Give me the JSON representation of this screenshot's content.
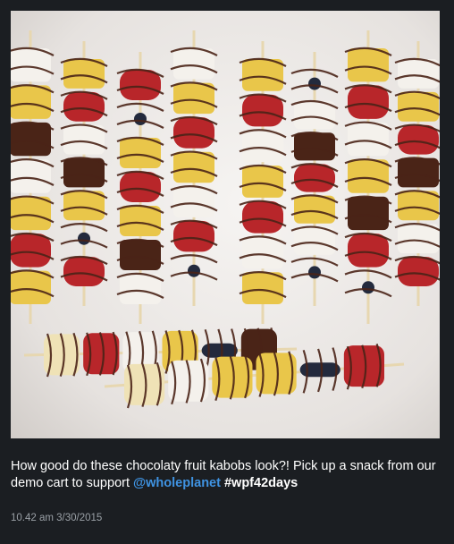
{
  "post": {
    "image": {
      "alt_subject": "chocolate drizzled fruit kabobs"
    },
    "caption": {
      "text": "How good do these chocolaty fruit kabobs look?! Pick up a snack from our demo cart to support ",
      "mention": "@wholeplanet",
      "hashtag": "#wpf42days"
    },
    "timestamp": "10.42 am 3/30/2015"
  },
  "colors": {
    "background": "#1b1e22",
    "caption_text": "#ffffff",
    "mention": "#3f93e2",
    "timestamp": "#9aa0a6"
  }
}
